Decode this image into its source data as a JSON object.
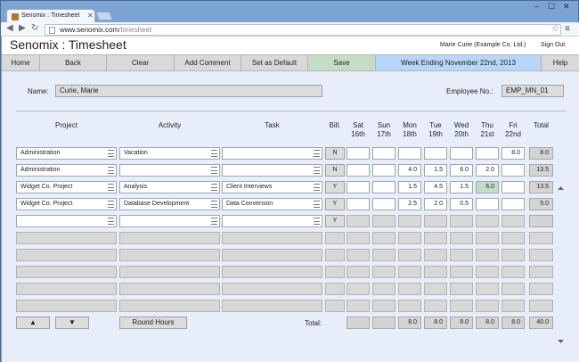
{
  "browser": {
    "tab_title": "Senomix : Timesheet",
    "url_domain": "www.senomix.com",
    "url_path": "/timesheet"
  },
  "header": {
    "app_title": "Senomix : Timesheet",
    "user": "Marie Curie  (Example Co. Ltd.)",
    "sign_out": "Sign Out"
  },
  "appbar": {
    "home": "Home",
    "back": "Back",
    "clear": "Clear",
    "add_comment": "Add Comment",
    "set_default": "Set as Default",
    "save": "Save",
    "week": "Week Ending November 22nd, 2013",
    "help": "Help"
  },
  "form": {
    "name_label": "Name:",
    "name_value": "Curie, Marie",
    "emp_label": "Employee No.:",
    "emp_value": "EMP_MN_01"
  },
  "columns": {
    "project": "Project",
    "activity": "Activity",
    "task": "Task",
    "bill": "Bill.",
    "days": [
      {
        "d": "Sat",
        "n": "16th"
      },
      {
        "d": "Sun",
        "n": "17th"
      },
      {
        "d": "Mon",
        "n": "18th"
      },
      {
        "d": "Tue",
        "n": "19th"
      },
      {
        "d": "Wed",
        "n": "20th"
      },
      {
        "d": "Thu",
        "n": "21st"
      },
      {
        "d": "Fri",
        "n": "22nd"
      }
    ],
    "total": "Total"
  },
  "rows": [
    {
      "project": "Administration",
      "activity": "Vacation",
      "task": "",
      "bill": "N",
      "hours": [
        "",
        "",
        "",
        "",
        "",
        "",
        "8.0"
      ],
      "total": "8.0"
    },
    {
      "project": "Administration",
      "activity": "",
      "task": "",
      "bill": "N",
      "hours": [
        "",
        "",
        "4.0",
        "1.5",
        "6.0",
        "2.0",
        ""
      ],
      "total": "13.5"
    },
    {
      "project": "Widget Co. Project",
      "activity": "Analysis",
      "task": "Client Interviews",
      "bill": "Y",
      "hours": [
        "",
        "",
        "1.5",
        "4.5",
        "1.5",
        "6.0",
        ""
      ],
      "total": "13.5"
    },
    {
      "project": "Widget Co. Project",
      "activity": "Database Development",
      "task": "Data Conversion",
      "bill": "Y",
      "hours": [
        "",
        "",
        "2.5",
        "2.0",
        "0.5",
        "",
        ""
      ],
      "total": "5.0"
    },
    {
      "project": "",
      "activity": "",
      "task": "",
      "bill": "Y",
      "hours": [
        "",
        "",
        "",
        "",
        "",
        "",
        ""
      ],
      "total": ""
    }
  ],
  "footer": {
    "up": "▲",
    "down": "▼",
    "round": "Round Hours",
    "total_label": "Total:",
    "day_totals": [
      "",
      "",
      "8.0",
      "8.0",
      "8.0",
      "8.0",
      "8.0"
    ],
    "grand_total": "40.0"
  },
  "icons": {
    "back": "◀",
    "forward": "▶",
    "reload": "↻",
    "star": "☆",
    "menu": "≡",
    "minimize": "–",
    "maximize": "☐",
    "close": "✕"
  }
}
